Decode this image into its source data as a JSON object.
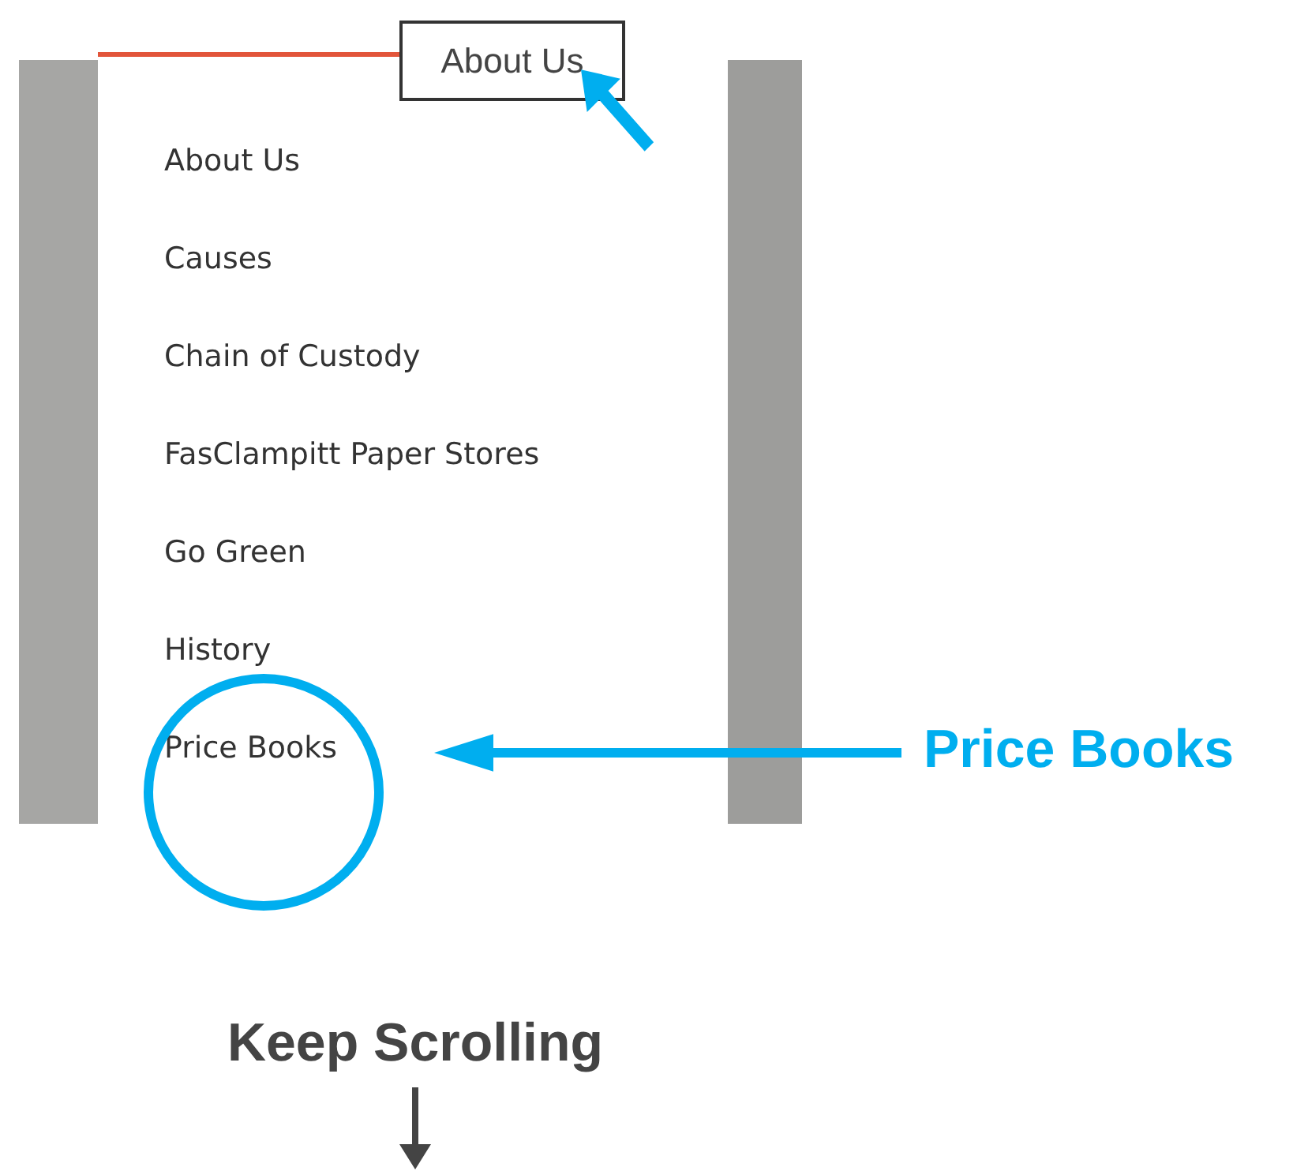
{
  "nav_tab": {
    "label": "About Us"
  },
  "menu": {
    "items": [
      {
        "label": "About Us"
      },
      {
        "label": "Causes"
      },
      {
        "label": "Chain of Custody"
      },
      {
        "label": "FasClampitt Paper Stores"
      },
      {
        "label": "Go Green"
      },
      {
        "label": "History"
      },
      {
        "label": "Price Books"
      }
    ]
  },
  "callout": {
    "label": "Price Books"
  },
  "footer": {
    "label": "Keep Scrolling"
  }
}
